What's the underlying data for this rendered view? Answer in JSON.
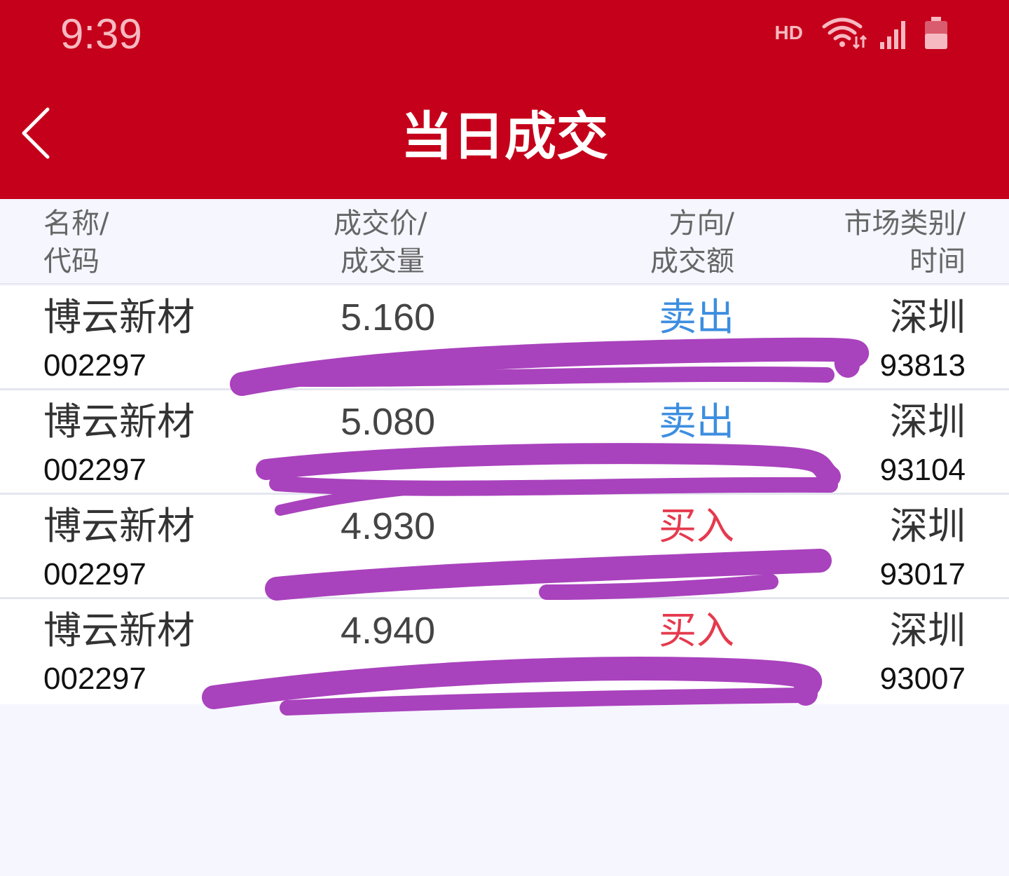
{
  "status_bar": {
    "time": "9:39",
    "network_label": "HD",
    "icons": [
      "wifi-icon",
      "signal-icon",
      "battery-icon"
    ]
  },
  "header": {
    "title": "当日成交",
    "back_icon": "chevron-left-icon",
    "background_color": "#c5001a"
  },
  "columns": {
    "name_code": {
      "line1": "名称/",
      "line2": "代码"
    },
    "price_volume": {
      "line1": "成交价/",
      "line2": "成交量"
    },
    "direction_amount": {
      "line1": "方向/",
      "line2": "成交额"
    },
    "market_time": {
      "line1": "市场类别/",
      "line2": "时间"
    }
  },
  "trades": [
    {
      "name": "博云新材",
      "code": "002297",
      "price": "5.160",
      "direction": "卖出",
      "direction_type": "sell",
      "market": "深圳",
      "time": "93813"
    },
    {
      "name": "博云新材",
      "code": "002297",
      "price": "5.080",
      "direction": "卖出",
      "direction_type": "sell",
      "market": "深圳",
      "time": "93104"
    },
    {
      "name": "博云新材",
      "code": "002297",
      "price": "4.930",
      "direction": "买入",
      "direction_type": "buy",
      "market": "深圳",
      "time": "93017"
    },
    {
      "name": "博云新材",
      "code": "002297",
      "price": "4.940",
      "direction": "买入",
      "direction_type": "buy",
      "market": "深圳",
      "time": "93007"
    }
  ],
  "colors": {
    "sell": "#3d8ee0",
    "buy": "#e53a4e",
    "redaction": "#a942bd"
  }
}
